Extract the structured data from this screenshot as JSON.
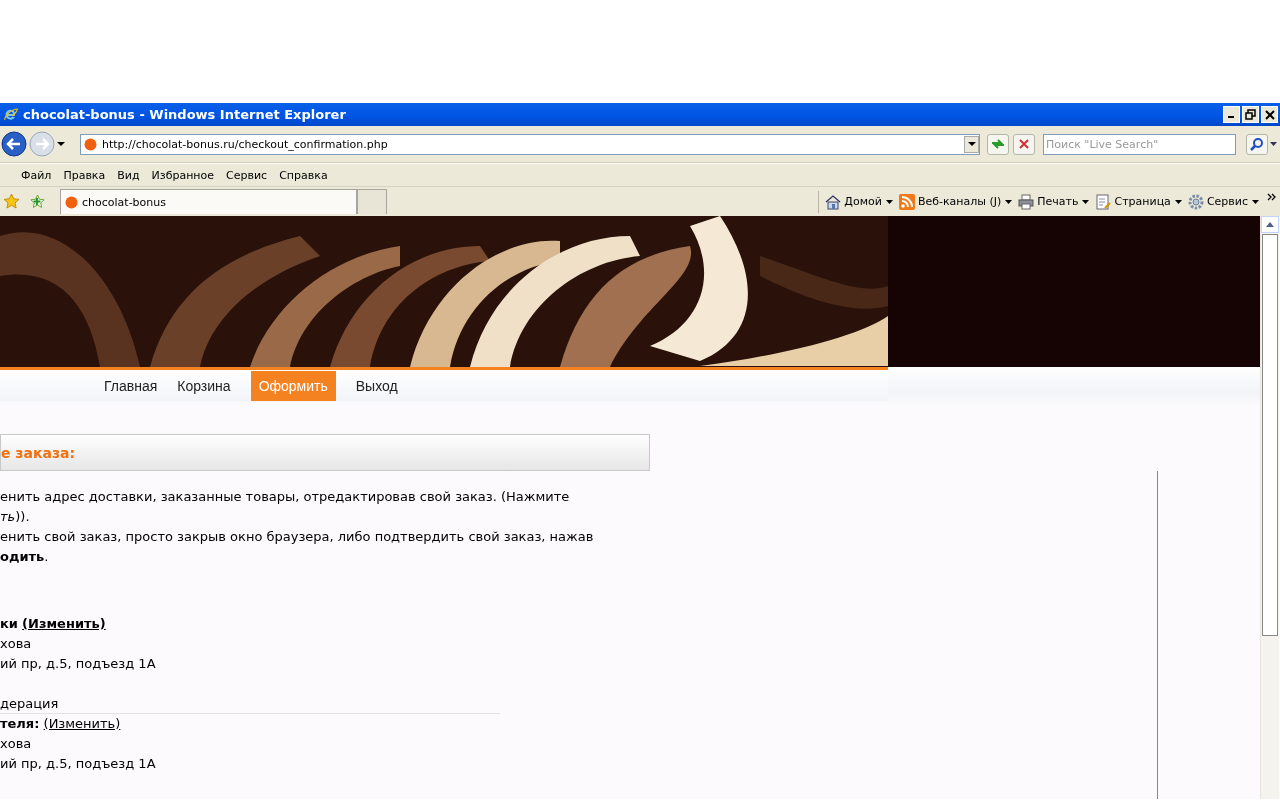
{
  "window": {
    "title": "chocolat-bonus - Windows Internet Explorer"
  },
  "address_bar": {
    "url": "http://chocolat-bonus.ru/checkout_confirmation.php"
  },
  "search": {
    "placeholder": "Поиск \"Live Search\""
  },
  "menu": [
    "Файл",
    "Правка",
    "Вид",
    "Избранное",
    "Сервис",
    "Справка"
  ],
  "tabs": [
    {
      "label": "chocolat-bonus",
      "selected": true
    }
  ],
  "commands": [
    {
      "label": "Домой",
      "kind": "home"
    },
    {
      "label": "Веб-каналы (J)",
      "kind": "feeds"
    },
    {
      "label": "Печать",
      "kind": "print"
    },
    {
      "label": "Страница",
      "kind": "page"
    },
    {
      "label": "Сервис",
      "kind": "tools"
    }
  ],
  "site_nav": [
    {
      "label": "Главная",
      "selected": false
    },
    {
      "label": "Корзина",
      "selected": false
    },
    {
      "label": "Оформить",
      "selected": true
    },
    {
      "label": "Выход",
      "selected": false
    }
  ],
  "panel": {
    "title": "е заказа:",
    "lines": [
      "енить адрес доставки, заказанные товары, отредактировав свой заказ. (Нажмите",
      "*ть*)).",
      "енить свой заказ, просто закрыв окно браузера, либо подтвердить свой заказ, нажав",
      "**одить**."
    ]
  },
  "shipping": {
    "heading": "ки",
    "edit_link": "(Изменить)",
    "lines": [
      "хова",
      "ий пр, д.5, подъезд 1А"
    ],
    "country": "дерация"
  },
  "billing": {
    "heading": "теля:",
    "edit_link": "(Изменить)",
    "lines": [
      "хова",
      "ий пр, д.5, подъезд 1А"
    ]
  }
}
